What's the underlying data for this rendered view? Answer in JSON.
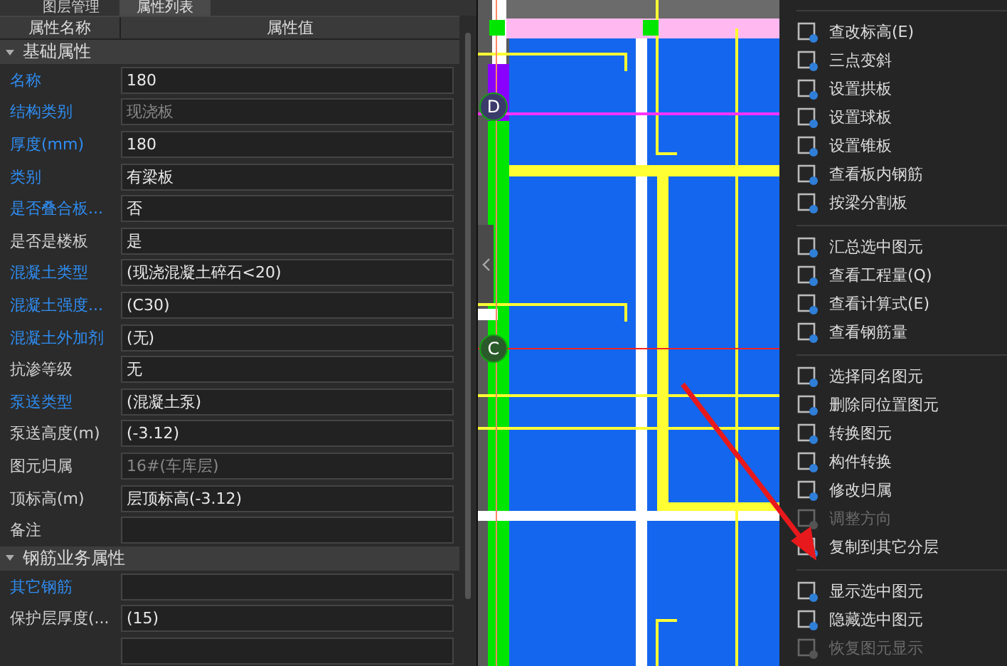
{
  "panel": {
    "tabs": [
      {
        "label": "图层管理",
        "selected": false
      },
      {
        "label": "属性列表",
        "selected": true
      }
    ],
    "columns": [
      "属性名称",
      "属性值"
    ],
    "groups": [
      {
        "title": "基础属性",
        "expanded": true,
        "rows": [
          {
            "name": "名称",
            "accent": true,
            "value": "180",
            "readonly": false
          },
          {
            "name": "结构类别",
            "accent": true,
            "value": "现浇板",
            "readonly": true
          },
          {
            "name": "厚度(mm)",
            "accent": true,
            "value": "180",
            "readonly": false
          },
          {
            "name": "类别",
            "accent": true,
            "value": "有梁板",
            "readonly": false
          },
          {
            "name": "是否叠合板...",
            "accent": true,
            "value": "否",
            "readonly": false
          },
          {
            "name": "是否是楼板",
            "accent": false,
            "value": "是",
            "readonly": false
          },
          {
            "name": "混凝土类型",
            "accent": true,
            "value": "(现浇混凝土碎石<20)",
            "readonly": false
          },
          {
            "name": "混凝土强度...",
            "accent": true,
            "value": "(C30)",
            "readonly": false
          },
          {
            "name": "混凝土外加剂",
            "accent": true,
            "value": "(无)",
            "readonly": false
          },
          {
            "name": "抗渗等级",
            "accent": false,
            "value": "无",
            "readonly": false
          },
          {
            "name": "泵送类型",
            "accent": true,
            "value": "(混凝土泵)",
            "readonly": false
          },
          {
            "name": "泵送高度(m)",
            "accent": false,
            "value": "(-3.12)",
            "readonly": false
          },
          {
            "name": "图元归属",
            "accent": false,
            "value": "16#(车库层)",
            "readonly": true
          },
          {
            "name": "顶标高(m)",
            "accent": false,
            "value": "层顶标高(-3.12)",
            "readonly": false
          },
          {
            "name": "备注",
            "accent": false,
            "readonly": false
          }
        ]
      },
      {
        "title": "钢筋业务属性",
        "expanded": true,
        "rows": [
          {
            "name": "其它钢筋",
            "accent": true,
            "readonly": false
          },
          {
            "name": "保护层厚度(...",
            "accent": false,
            "value": "(15)",
            "readonly": false
          },
          {
            "readonly": false
          }
        ]
      }
    ]
  },
  "canvas": {
    "axis_labels": [
      "D",
      "C"
    ]
  },
  "context_menu": {
    "groups": [
      [
        {
          "label": "查改标高(E)",
          "disabled": false
        },
        {
          "label": "三点变斜",
          "disabled": false
        },
        {
          "label": "设置拱板",
          "disabled": false
        },
        {
          "label": "设置球板",
          "disabled": false
        },
        {
          "label": "设置锥板",
          "disabled": false
        },
        {
          "label": "查看板内钢筋",
          "disabled": false
        },
        {
          "label": "按梁分割板",
          "disabled": false
        }
      ],
      [
        {
          "label": "汇总选中图元",
          "disabled": false
        },
        {
          "label": "查看工程量(Q)",
          "disabled": false
        },
        {
          "label": "查看计算式(E)",
          "disabled": false
        },
        {
          "label": "查看钢筋量",
          "disabled": false
        }
      ],
      [
        {
          "label": "选择同名图元",
          "disabled": false
        },
        {
          "label": "删除同位置图元",
          "disabled": false
        },
        {
          "label": "转换图元",
          "disabled": false
        },
        {
          "label": "构件转换",
          "disabled": false
        },
        {
          "label": "修改归属",
          "disabled": false
        },
        {
          "label": "调整方向",
          "disabled": true
        },
        {
          "label": "复制到其它分层",
          "disabled": false
        }
      ],
      [
        {
          "label": "显示选中图元",
          "disabled": false
        },
        {
          "label": "隐藏选中图元",
          "disabled": false
        },
        {
          "label": "恢复图元显示",
          "disabled": true
        }
      ]
    ]
  }
}
